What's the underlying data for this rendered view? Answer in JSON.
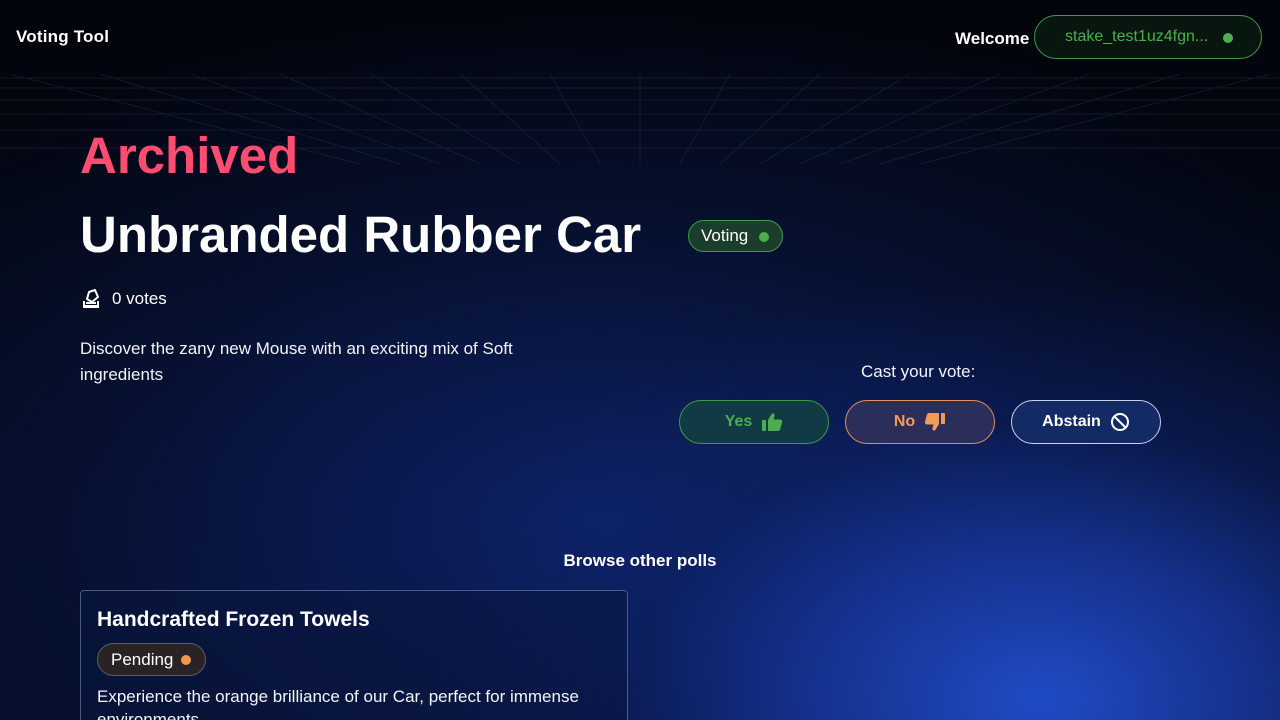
{
  "header": {
    "brand": "Voting Tool",
    "welcome": "Welcome",
    "wallet_address": "stake_test1uz4fgn...",
    "wallet_status_color": "#4cae4f"
  },
  "poll": {
    "archived_label": "Archived",
    "title": "Unbranded Rubber Car",
    "status": "Voting",
    "status_color": "#4cae4f",
    "votes": "0 votes",
    "description": "Discover the zany new Mouse with an exciting mix of Soft ingredients"
  },
  "vote": {
    "prompt": "Cast your vote:",
    "yes_label": "Yes",
    "no_label": "No",
    "abstain_label": "Abstain",
    "yes_icon": "thumbs-up-icon",
    "no_icon": "thumbs-down-icon",
    "abstain_icon": "prohibited-icon"
  },
  "browse": {
    "heading": "Browse other polls",
    "polls": [
      {
        "title": "Handcrafted Frozen Towels",
        "status": "Pending",
        "status_color": "#f5964f",
        "description": "Experience the orange brilliance of our Car, perfect for immense environments"
      }
    ]
  },
  "colors": {
    "archived": "#ff4d71",
    "accent_green": "#4cae4f",
    "accent_orange": "#f29a5a"
  }
}
